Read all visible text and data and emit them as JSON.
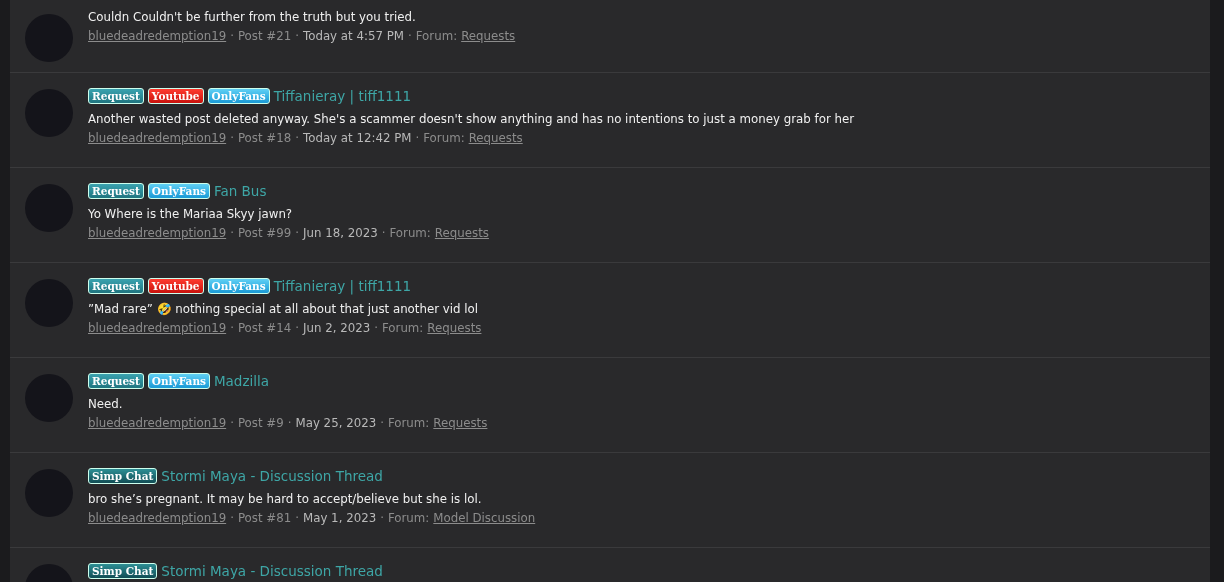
{
  "posts": [
    {
      "body": "Couldn Couldn't be further from the truth but you tried.",
      "meta": [
        {
          "kind": "author",
          "text": "bluedeadredemption19"
        },
        {
          "kind": "sep",
          "text": "·"
        },
        {
          "kind": "plain",
          "text": "Post #21"
        },
        {
          "kind": "sep",
          "text": "·"
        },
        {
          "kind": "date",
          "text": "Today at 4:57 PM"
        },
        {
          "kind": "sep",
          "text": "·"
        },
        {
          "kind": "plain",
          "text": "Forum:"
        },
        {
          "kind": "link",
          "text": "Requests"
        }
      ]
    },
    {
      "tags": [
        {
          "kind": "request",
          "label": "Request"
        },
        {
          "kind": "youtube",
          "label": "Youtube"
        },
        {
          "kind": "onlyfans",
          "label": "OnlyFans"
        }
      ],
      "title": "Tiffanieray | tiff1111",
      "body": "Another wasted post deleted anyway. She's a scammer doesn't show anything and has no intentions to just a money grab for her",
      "meta": [
        {
          "kind": "author",
          "text": "bluedeadredemption19"
        },
        {
          "kind": "sep",
          "text": "·"
        },
        {
          "kind": "plain",
          "text": "Post #18"
        },
        {
          "kind": "sep",
          "text": "·"
        },
        {
          "kind": "date",
          "text": "Today at 12:42 PM"
        },
        {
          "kind": "sep",
          "text": "·"
        },
        {
          "kind": "plain",
          "text": "Forum:"
        },
        {
          "kind": "link",
          "text": "Requests"
        }
      ]
    },
    {
      "tags": [
        {
          "kind": "request",
          "label": "Request"
        },
        {
          "kind": "onlyfans",
          "label": "OnlyFans"
        }
      ],
      "title": "Fan Bus",
      "body": "Yo Where is the Mariaa Skyy jawn?",
      "meta": [
        {
          "kind": "author",
          "text": "bluedeadredemption19"
        },
        {
          "kind": "sep",
          "text": "·"
        },
        {
          "kind": "plain",
          "text": "Post #99"
        },
        {
          "kind": "sep",
          "text": "·"
        },
        {
          "kind": "date",
          "text": "Jun 18, 2023"
        },
        {
          "kind": "sep",
          "text": "·"
        },
        {
          "kind": "plain",
          "text": "Forum:"
        },
        {
          "kind": "link",
          "text": "Requests"
        }
      ]
    },
    {
      "tags": [
        {
          "kind": "request",
          "label": "Request"
        },
        {
          "kind": "youtube",
          "label": "Youtube"
        },
        {
          "kind": "onlyfans",
          "label": "OnlyFans"
        }
      ],
      "title": "Tiffanieray | tiff1111",
      "body": "”Mad rare” 🤣 nothing special at all about that just another vid lol",
      "meta": [
        {
          "kind": "author",
          "text": "bluedeadredemption19"
        },
        {
          "kind": "sep",
          "text": "·"
        },
        {
          "kind": "plain",
          "text": "Post #14"
        },
        {
          "kind": "sep",
          "text": "·"
        },
        {
          "kind": "date",
          "text": "Jun 2, 2023"
        },
        {
          "kind": "sep",
          "text": "·"
        },
        {
          "kind": "plain",
          "text": "Forum:"
        },
        {
          "kind": "link",
          "text": "Requests"
        }
      ]
    },
    {
      "tags": [
        {
          "kind": "request",
          "label": "Request"
        },
        {
          "kind": "onlyfans",
          "label": "OnlyFans"
        }
      ],
      "title": "Madzilla",
      "body": "Need.",
      "meta": [
        {
          "kind": "author",
          "text": "bluedeadredemption19"
        },
        {
          "kind": "sep",
          "text": "·"
        },
        {
          "kind": "plain",
          "text": "Post #9"
        },
        {
          "kind": "sep",
          "text": "·"
        },
        {
          "kind": "date",
          "text": "May 25, 2023"
        },
        {
          "kind": "sep",
          "text": "·"
        },
        {
          "kind": "plain",
          "text": "Forum:"
        },
        {
          "kind": "link",
          "text": "Requests"
        }
      ]
    },
    {
      "tags": [
        {
          "kind": "simp",
          "label": "Simp Chat"
        }
      ],
      "title": "Stormi Maya - Discussion Thread",
      "body": "bro she’s pregnant. It may be hard to accept/believe but she is lol.",
      "meta": [
        {
          "kind": "author",
          "text": "bluedeadredemption19"
        },
        {
          "kind": "sep",
          "text": "·"
        },
        {
          "kind": "plain",
          "text": "Post #81"
        },
        {
          "kind": "sep",
          "text": "·"
        },
        {
          "kind": "date",
          "text": "May 1, 2023"
        },
        {
          "kind": "sep",
          "text": "·"
        },
        {
          "kind": "plain",
          "text": "Forum:"
        },
        {
          "kind": "link",
          "text": "Model Discussion"
        }
      ]
    },
    {
      "tags": [
        {
          "kind": "simp",
          "label": "Simp Chat"
        }
      ],
      "title": "Stormi Maya - Discussion Thread"
    }
  ]
}
